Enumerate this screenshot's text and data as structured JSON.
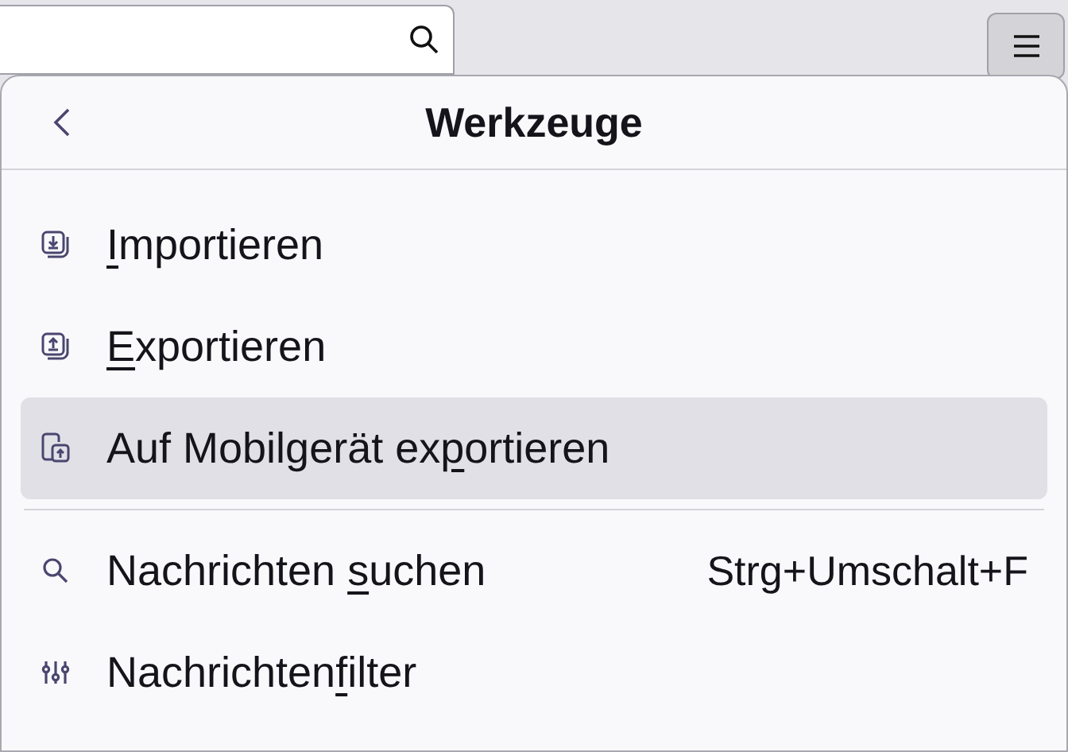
{
  "panel": {
    "title": "Werkzeuge",
    "items": [
      {
        "kind": "item",
        "label": "Importieren",
        "hovered": false
      },
      {
        "kind": "item",
        "label": "Exportieren",
        "hovered": false
      },
      {
        "kind": "item",
        "label": "Auf Mobilgerät exportieren",
        "hovered": true
      },
      {
        "kind": "separator"
      },
      {
        "kind": "item",
        "label": "Nachrichten suchen",
        "shortcut": "Strg+Umschalt+F",
        "hovered": false
      },
      {
        "kind": "item",
        "label": "Nachrichtenfilter",
        "hovered": false
      }
    ]
  }
}
